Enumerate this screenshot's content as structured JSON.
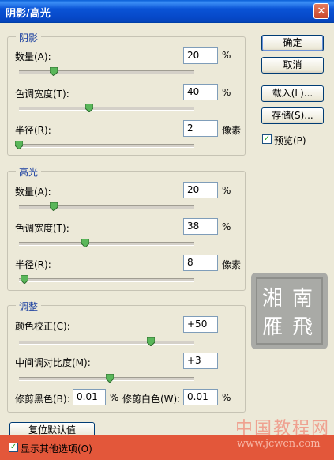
{
  "window": {
    "title": "阴影/高光",
    "close_glyph": "✕"
  },
  "shadows": {
    "legend": "阴影",
    "amount": {
      "label": "数量(A):",
      "value": "20",
      "unit": "%",
      "slider_fraction": 0.2
    },
    "tonal_width": {
      "label": "色调宽度(T):",
      "value": "40",
      "unit": "%",
      "slider_fraction": 0.4
    },
    "radius": {
      "label": "半径(R):",
      "value": "2",
      "unit": "像素",
      "slider_fraction": 0.0
    }
  },
  "highlights": {
    "legend": "高光",
    "amount": {
      "label": "数量(A):",
      "value": "20",
      "unit": "%",
      "slider_fraction": 0.2
    },
    "tonal_width": {
      "label": "色调宽度(T):",
      "value": "38",
      "unit": "%",
      "slider_fraction": 0.38
    },
    "radius": {
      "label": "半径(R):",
      "value": "8",
      "unit": "像素",
      "slider_fraction": 0.03
    }
  },
  "adjustments": {
    "legend": "调整",
    "color_correction": {
      "label": "颜色校正(C):",
      "value": "+50",
      "slider_fraction": 0.75
    },
    "midtone_contrast": {
      "label": "中间调对比度(M):",
      "value": "+3",
      "slider_fraction": 0.52
    },
    "clip_black": {
      "label": "修剪黑色(B):",
      "value": "0.01",
      "unit": "%"
    },
    "clip_white": {
      "label": "修剪白色(W):",
      "value": "0.01",
      "unit": "%"
    }
  },
  "buttons": {
    "ok": "确定",
    "cancel": "取消",
    "load": "载入(L)...",
    "save": "存储(S)...",
    "reset": "复位默认值"
  },
  "preview": {
    "label": "预览(P)",
    "checked": true
  },
  "show_more": {
    "label": "显示其他选项(O)",
    "checked": true
  },
  "watermark": {
    "stamp_text": "南湘飛雁",
    "site": "中国教程网",
    "url": "www.jcwcn.com"
  },
  "colors": {
    "title_bar": "#0a53d6",
    "accent_red": "#e3573a",
    "legend_blue": "#1a3fa0"
  }
}
